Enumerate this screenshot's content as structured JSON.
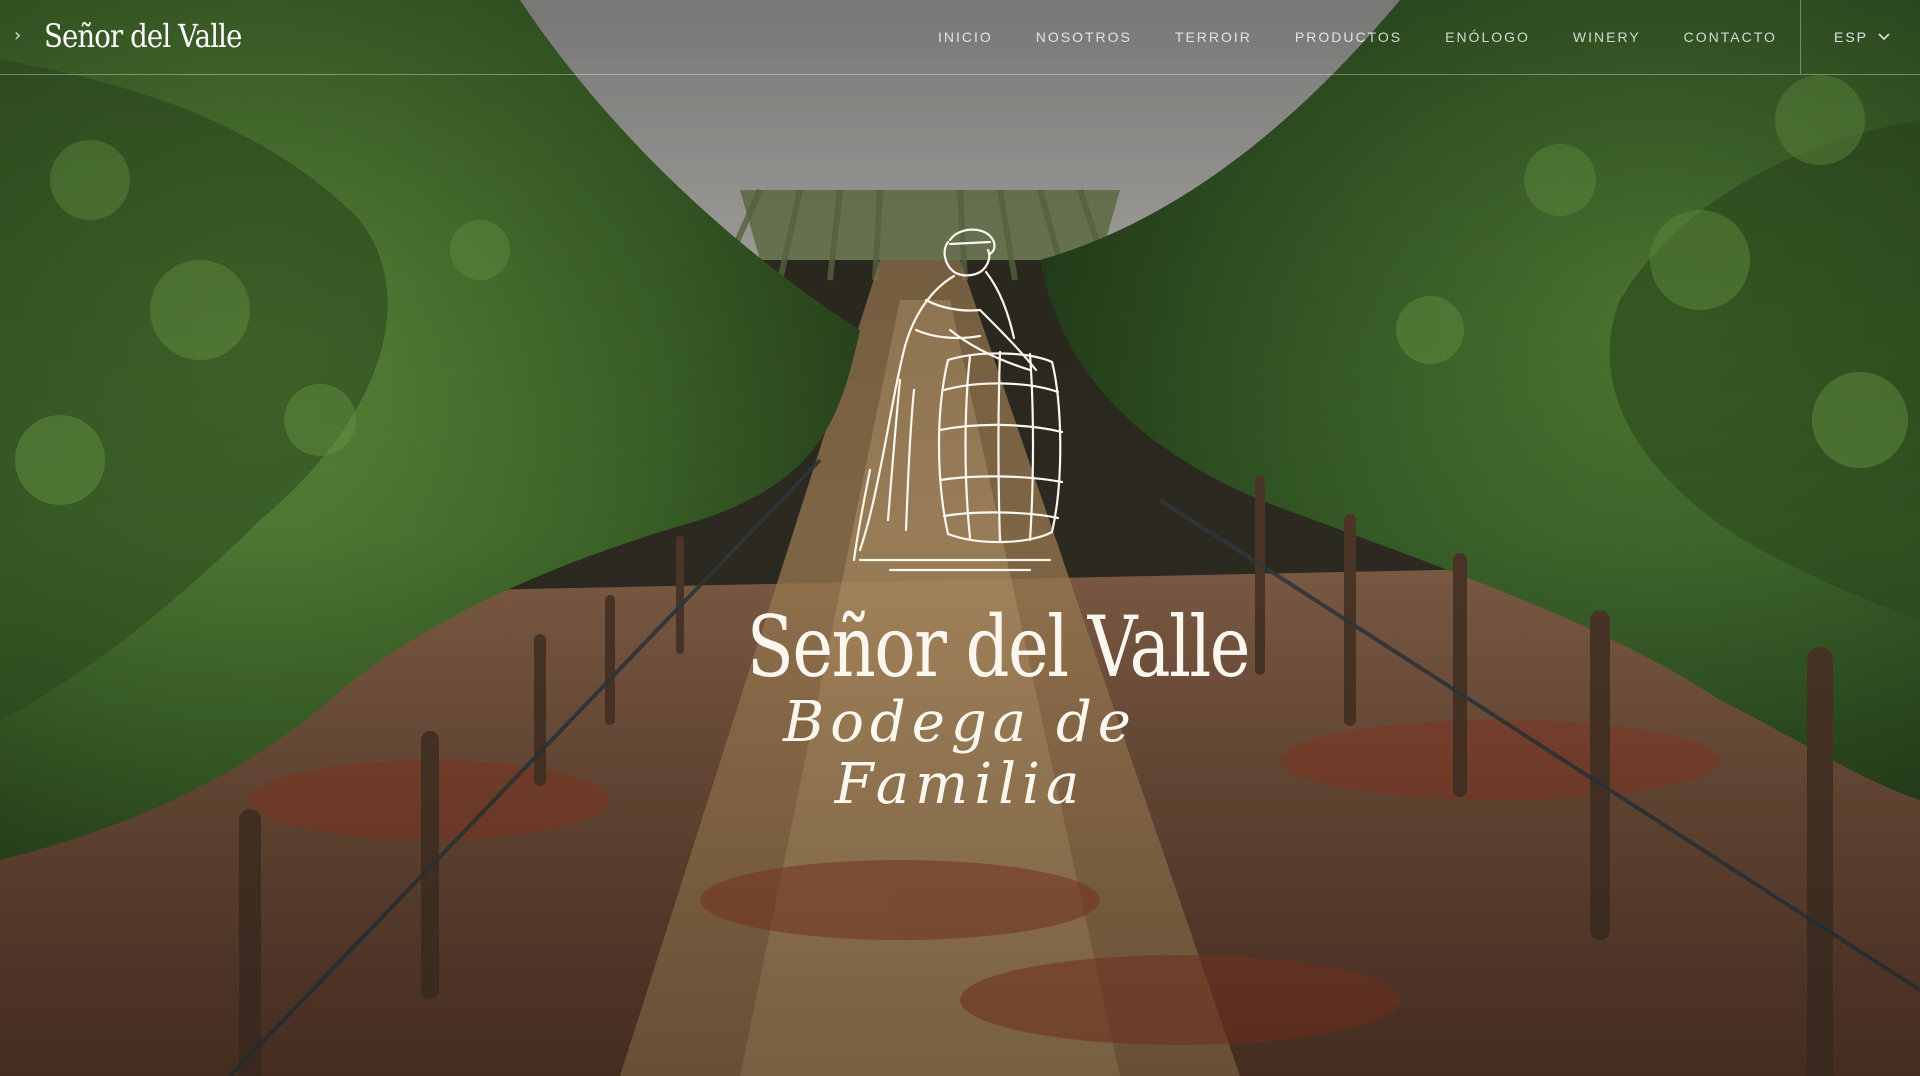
{
  "brand": {
    "name": "Señor del Valle"
  },
  "nav": {
    "items": [
      {
        "label": "INICIO"
      },
      {
        "label": "NOSOTROS"
      },
      {
        "label": "TERROIR"
      },
      {
        "label": "PRODUCTOS"
      },
      {
        "label": "ENÓLOGO"
      },
      {
        "label": "WINERY"
      },
      {
        "label": "CONTACTO"
      }
    ]
  },
  "language": {
    "selected": "ESP",
    "icon": "chevron-down-icon"
  },
  "hero": {
    "title": "Señor del Valle",
    "subtitle": "Bodega de Familia",
    "illustration": "winemaker-with-barrel-illustration"
  },
  "colors": {
    "text": "#ffffff",
    "sky": "#9a9a98",
    "foliage": "#3f6a2b",
    "soil": "#6b4a36"
  }
}
